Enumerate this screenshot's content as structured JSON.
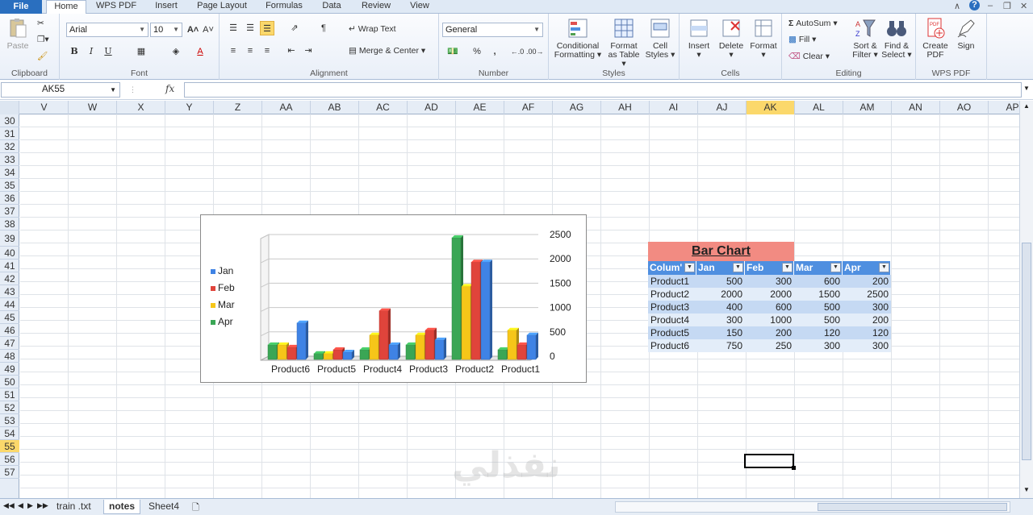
{
  "ribbon": {
    "file_tab": "File",
    "tabs": [
      "Home",
      "WPS PDF",
      "Insert",
      "Page Layout",
      "Formulas",
      "Data",
      "Review",
      "View"
    ],
    "active_tab": "Home",
    "groups": {
      "clipboard": {
        "label": "Clipboard",
        "paste": "Paste"
      },
      "font": {
        "label": "Font",
        "font_name": "Arial",
        "font_size": "10",
        "bold": "B",
        "italic": "I",
        "underline": "U"
      },
      "alignment": {
        "label": "Alignment",
        "wrap_text": "Wrap Text",
        "merge_center": "Merge & Center"
      },
      "number": {
        "label": "Number",
        "format": "General",
        "percent": "%",
        "comma": ","
      },
      "styles": {
        "label": "Styles",
        "conditional_1": "Conditional",
        "conditional_2": "Formatting",
        "format_table_1": "Format",
        "format_table_2": "as Table",
        "cell_styles_1": "Cell",
        "cell_styles_2": "Styles"
      },
      "cells": {
        "label": "Cells",
        "insert": "Insert",
        "delete": "Delete",
        "format": "Format"
      },
      "editing": {
        "label": "Editing",
        "autosum": "AutoSum",
        "fill": "Fill",
        "clear": "Clear",
        "sort_1": "Sort &",
        "sort_2": "Filter",
        "find_1": "Find &",
        "find_2": "Select"
      },
      "wps_pdf": {
        "label": "WPS PDF",
        "create_1": "Create",
        "create_2": "PDF",
        "sign": "Sign"
      }
    }
  },
  "formula_bar": {
    "name_box": "AK55",
    "fx": "fx",
    "content": ""
  },
  "columns": [
    "V",
    "W",
    "X",
    "Y",
    "Z",
    "AA",
    "AB",
    "AC",
    "AD",
    "AE",
    "AF",
    "AG",
    "AH",
    "AI",
    "AJ",
    "AK",
    "AL",
    "AM",
    "AN",
    "AO",
    "AP"
  ],
  "selected_column": "AK",
  "rows": [
    "30",
    "31",
    "32",
    "33",
    "34",
    "35",
    "36",
    "37",
    "38",
    "39",
    "40",
    "41",
    "42",
    "43",
    "44",
    "45",
    "46",
    "47",
    "48",
    "49",
    "50",
    "51",
    "52",
    "53",
    "54",
    "55",
    "56",
    "57"
  ],
  "selected_row": "55",
  "chart_data": {
    "type": "bar",
    "categories": [
      "Product6",
      "Product5",
      "Product4",
      "Product3",
      "Product2",
      "Product1"
    ],
    "series": [
      {
        "name": "Apr",
        "color": "#3aa655",
        "values": [
          300,
          120,
          200,
          300,
          2500,
          200
        ]
      },
      {
        "name": "Mar",
        "color": "#f6c619",
        "values": [
          300,
          120,
          500,
          500,
          1500,
          600
        ]
      },
      {
        "name": "Feb",
        "color": "#e0443b",
        "values": [
          250,
          200,
          1000,
          600,
          2000,
          300
        ]
      },
      {
        "name": "Jan",
        "color": "#3f83e5",
        "values": [
          750,
          150,
          300,
          400,
          2000,
          500
        ]
      }
    ],
    "legend_order": [
      "Jan",
      "Feb",
      "Mar",
      "Apr"
    ],
    "y_ticks": [
      "0",
      "500",
      "1000",
      "1500",
      "2000",
      "2500"
    ],
    "ylim": [
      0,
      2500
    ],
    "legend_position": "left",
    "grid": true
  },
  "table": {
    "title": "Bar Chart",
    "headers": [
      "Colum'",
      "Jan",
      "Feb",
      "Mar",
      "Apr"
    ],
    "rows": [
      [
        "Product1",
        "500",
        "300",
        "600",
        "200"
      ],
      [
        "Product2",
        "2000",
        "2000",
        "1500",
        "2500"
      ],
      [
        "Product3",
        "400",
        "600",
        "500",
        "300"
      ],
      [
        "Product4",
        "300",
        "1000",
        "500",
        "200"
      ],
      [
        "Product5",
        "150",
        "200",
        "120",
        "120"
      ],
      [
        "Product6",
        "750",
        "250",
        "300",
        "300"
      ]
    ]
  },
  "sheets": [
    "train .txt",
    "notes",
    "Sheet4"
  ],
  "active_sheet": "notes",
  "watermark": "نفذلي"
}
